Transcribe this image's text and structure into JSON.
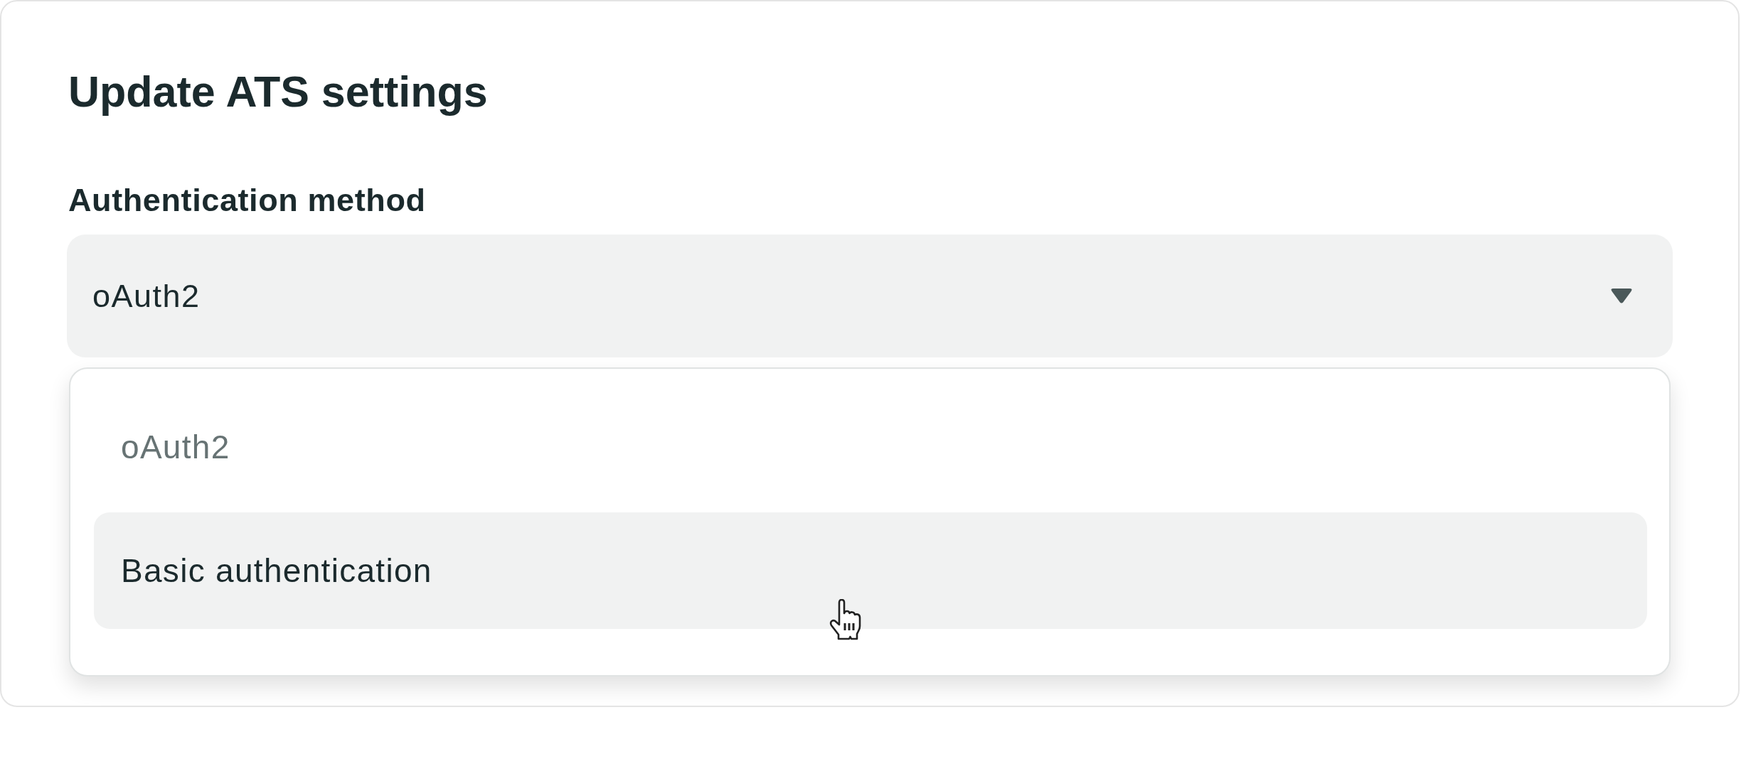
{
  "form": {
    "title": "Update ATS settings",
    "field": {
      "label": "Authentication method",
      "value": "oAuth2",
      "expanded": true
    },
    "options": [
      {
        "label": "oAuth2",
        "selected": true,
        "hovered": false
      },
      {
        "label": "Basic authentication",
        "selected": false,
        "hovered": true
      }
    ]
  }
}
